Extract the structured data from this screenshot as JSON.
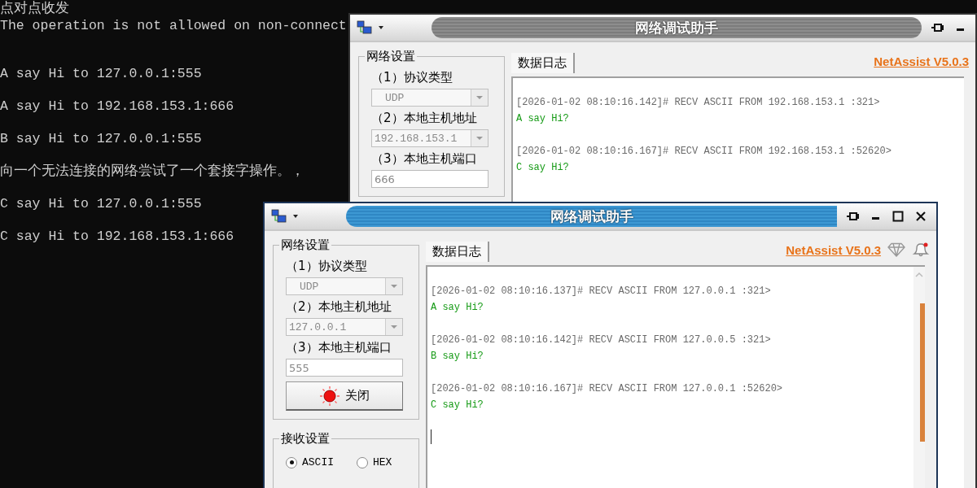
{
  "console": {
    "lines": [
      "点对点收发",
      "The operation is not allowed on non-connect",
      "A say Hi to 127.0.0.1:555",
      "A say Hi to 192.168.153.1:666",
      "B say Hi to 127.0.0.1:555",
      "向一个无法连接的网络尝试了一个套接字操作。，",
      "C say Hi to 127.0.0.1:555",
      "C say Hi to 192.168.153.1:666"
    ]
  },
  "windows": [
    {
      "title": "网络调试助手",
      "active": false,
      "network_settings": {
        "title": "网络设置",
        "protocol_label": "（1）协议类型",
        "protocol": "UDP",
        "host_label": "（2）本地主机地址",
        "host": "192.168.153.1",
        "port_label": "（3）本地主机端口",
        "port": "666"
      },
      "tab": "数据日志",
      "brand_link": "NetAssist V5.0.3",
      "log": [
        {
          "header": "[2026-01-02 08:10:16.142]# RECV ASCII FROM 192.168.153.1 :321>",
          "message": "A say Hi?"
        },
        {
          "header": "[2026-01-02 08:10:16.167]# RECV ASCII FROM 192.168.153.1 :52620>",
          "message": "C say Hi?"
        }
      ]
    },
    {
      "title": "网络调试助手",
      "active": true,
      "network_settings": {
        "title": "网络设置",
        "protocol_label": "（1）协议类型",
        "protocol": "UDP",
        "host_label": "（2）本地主机地址",
        "host": "127.0.0.1",
        "port_label": "（3）本地主机端口",
        "port": "555"
      },
      "button": "关闭",
      "receive_settings": {
        "title": "接收设置",
        "options": [
          {
            "label": "ASCII",
            "selected": true
          },
          {
            "label": "HEX",
            "selected": false
          }
        ]
      },
      "tab": "数据日志",
      "brand_link": "NetAssist V5.0.3",
      "log": [
        {
          "header": "[2026-01-02 08:10:16.137]# RECV ASCII FROM 127.0.0.1 :321>",
          "message": "A say Hi?"
        },
        {
          "header": "[2026-01-02 08:10:16.142]# RECV ASCII FROM 127.0.0.5 :321>",
          "message": "B say Hi?"
        },
        {
          "header": "[2026-01-02 08:10:16.167]# RECV ASCII FROM 127.0.0.1 :52620>",
          "message": "C say Hi?"
        }
      ]
    }
  ]
}
